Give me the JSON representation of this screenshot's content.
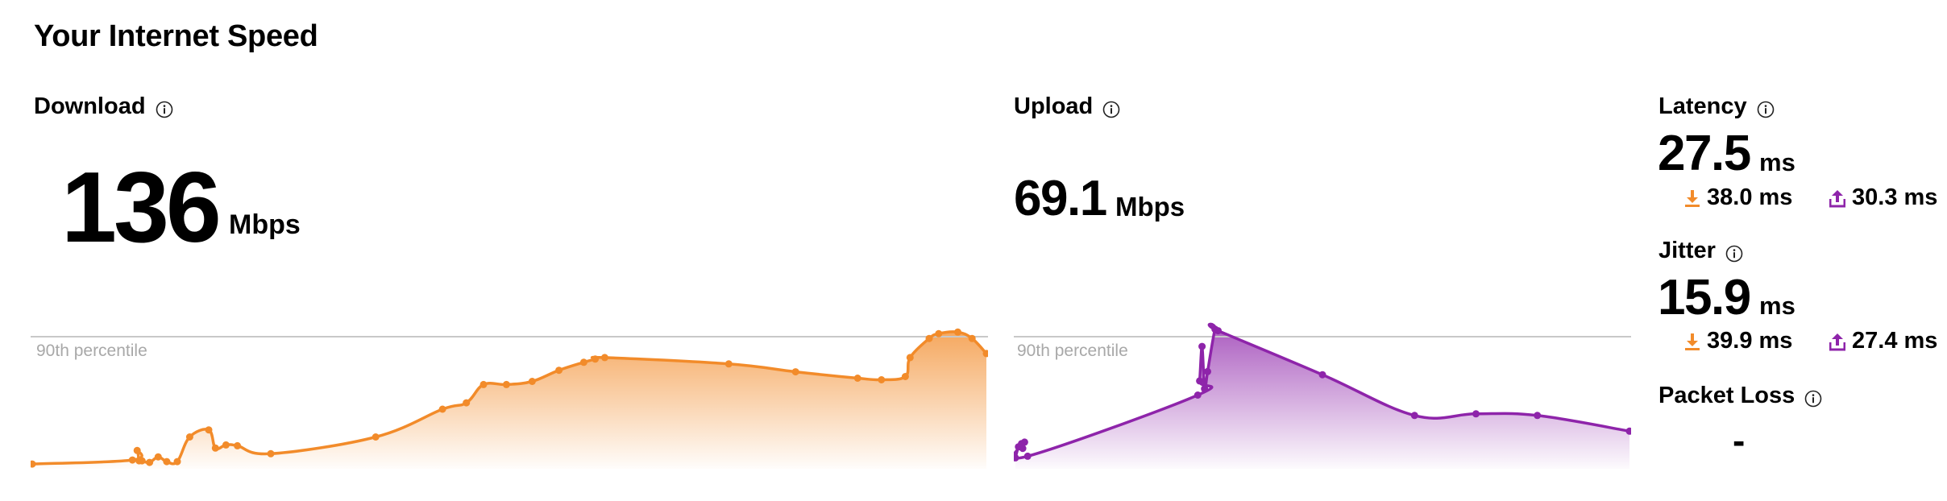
{
  "page": {
    "title": "Your Internet Speed"
  },
  "colors": {
    "download": "#f28b2a",
    "upload": "#8e24aa",
    "percentile_line": "#c8c8c8",
    "percentile_text": "#a8a8a8"
  },
  "download": {
    "label": "Download",
    "info_icon": "info-icon",
    "value": "136",
    "unit": "Mbps",
    "percentile_label": "90th percentile"
  },
  "upload": {
    "label": "Upload",
    "info_icon": "info-icon",
    "value": "69.1",
    "unit": "Mbps",
    "percentile_label": "90th percentile"
  },
  "latency": {
    "label": "Latency",
    "value": "27.5",
    "unit": "ms",
    "download_value": "38.0 ms",
    "upload_value": "30.3 ms"
  },
  "jitter": {
    "label": "Jitter",
    "value": "15.9",
    "unit": "ms",
    "download_value": "39.9 ms",
    "upload_value": "27.4 ms"
  },
  "packet_loss": {
    "label": "Packet Loss",
    "value": "-"
  },
  "chart_data": [
    {
      "type": "area",
      "name": "download",
      "percentile_label": "90th percentile",
      "percentile_90": 136,
      "ylim": [
        0,
        225
      ],
      "x": [
        0,
        10.5,
        11,
        11.2,
        11.5,
        12.3,
        13.2,
        14.1,
        15.2,
        16.5,
        18.5,
        19.2,
        20.3,
        21.5,
        25,
        36,
        43,
        45.5,
        47.3,
        49.7,
        52.4,
        55.2,
        57.8,
        59,
        60,
        73,
        80,
        86.5,
        89,
        91.5,
        92,
        94,
        95,
        97,
        98.5,
        100
      ],
      "y": [
        6,
        11,
        23,
        10,
        10,
        8,
        15,
        9,
        9,
        40,
        49,
        26,
        30,
        29,
        19,
        40,
        75,
        83,
        106,
        106,
        110,
        124,
        134,
        138,
        140,
        132,
        122,
        114,
        112,
        116,
        140,
        164,
        170,
        172,
        164,
        145
      ]
    },
    {
      "type": "area",
      "name": "upload",
      "percentile_label": "90th percentile",
      "percentile_90": 69.1,
      "ylim": [
        0,
        114
      ],
      "x": [
        0,
        0.5,
        1,
        1.2,
        1.5,
        2,
        29.7,
        30,
        30.4,
        30.8,
        31.3,
        32.5,
        33,
        50,
        65,
        75,
        85,
        100
      ],
      "y": [
        7,
        14,
        16,
        13,
        17,
        8,
        47,
        56,
        78,
        51,
        62,
        89,
        88,
        60,
        34,
        35,
        34,
        24
      ]
    }
  ]
}
